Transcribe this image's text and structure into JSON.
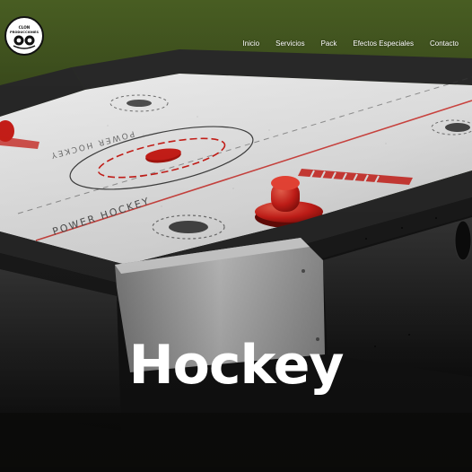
{
  "brand": {
    "logo_text": "CLON PRODUCCIONES"
  },
  "nav": {
    "items": [
      "Inicio",
      "Servicios",
      "Pack",
      "Efectos Especiales",
      "Contacto"
    ]
  },
  "hero": {
    "title": "Hockey",
    "table_markings": {
      "top_text": "POWER HOCKEY",
      "bottom_text": "POWER HOCKEY"
    }
  },
  "colors": {
    "nav_text": "#ffffff",
    "title": "#ffffff",
    "accent_red": "#d8201a",
    "table_surface": "#f1f1f1",
    "table_frame": "#2a2a2a"
  }
}
